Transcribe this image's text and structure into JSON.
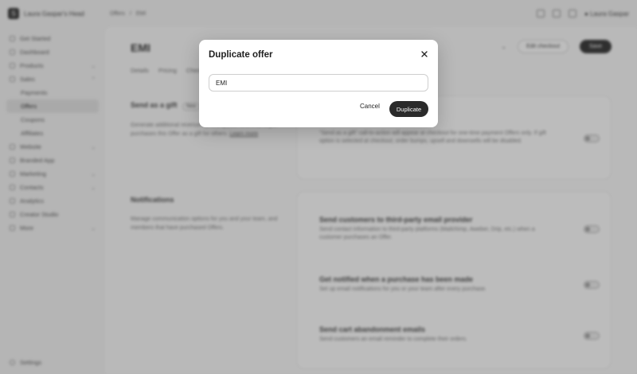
{
  "topbar": {
    "school_name": "Laura Gaspar's Head",
    "breadcrumbs": [
      "Offers",
      "/",
      "EMI"
    ],
    "user_name": "Laura Gaspar"
  },
  "sidebar": {
    "items": [
      {
        "label": "Get Started",
        "icon": "rocket-icon"
      },
      {
        "label": "Dashboard",
        "icon": "dashboard-icon"
      },
      {
        "label": "Products",
        "icon": "box-icon",
        "chevron": "⌄"
      },
      {
        "label": "Sales",
        "icon": "tag-icon",
        "chevron": "⌃"
      },
      {
        "label": "Payments",
        "sub": true
      },
      {
        "label": "Offers",
        "sub": true,
        "active": true
      },
      {
        "label": "Coupons",
        "sub": true
      },
      {
        "label": "Affiliates",
        "sub": true
      },
      {
        "label": "Website",
        "icon": "globe-icon",
        "chevron": "⌄"
      },
      {
        "label": "Branded App",
        "icon": "phone-icon"
      },
      {
        "label": "Marketing",
        "icon": "megaphone-icon",
        "chevron": "⌄"
      },
      {
        "label": "Contacts",
        "icon": "contacts-icon",
        "chevron": "⌄"
      },
      {
        "label": "Analytics",
        "icon": "chart-icon"
      },
      {
        "label": "Creator Studio",
        "icon": "studio-icon"
      },
      {
        "label": "More",
        "icon": "more-icon",
        "chevron": "⌄"
      }
    ],
    "settings_label": "Settings"
  },
  "main": {
    "title": "EMI",
    "edit_checkout_label": "Edit checkout",
    "save_label": "Save",
    "tabs": [
      "Details",
      "Pricing",
      "Checkout"
    ],
    "gift": {
      "title": "Send as a gift",
      "badge": "New",
      "desc": "Generate additional revenue by selling your Offers as a gift, purchases this Offer as a gift for others.",
      "learn_more": "Learn more",
      "option_desc": "\"Send as a gift\" call-to-action will appear at checkout for one-time payment Offers only. If gift option is selected at checkout, order bumps, upsell and downsells will be disabled."
    },
    "notifications": {
      "title": "Notifications",
      "desc": "Manage communication options for you and your team, and members that have purchased Offers.",
      "options": [
        {
          "title": "Send customers to third-party email provider",
          "desc": "Send contact information to third-party platforms (Mailchimp, Aweber, Drip, etc.) when a customer purchases an Offer."
        },
        {
          "title": "Get notified when a purchase has been made",
          "desc": "Set up email notifications for you or your team after every purchase."
        },
        {
          "title": "Send cart abandonment emails",
          "desc": "Send customers an email reminder to complete their orders."
        }
      ]
    }
  },
  "modal": {
    "title": "Duplicate offer",
    "input_value": "EMI",
    "cancel_label": "Cancel",
    "duplicate_label": "Duplicate"
  }
}
